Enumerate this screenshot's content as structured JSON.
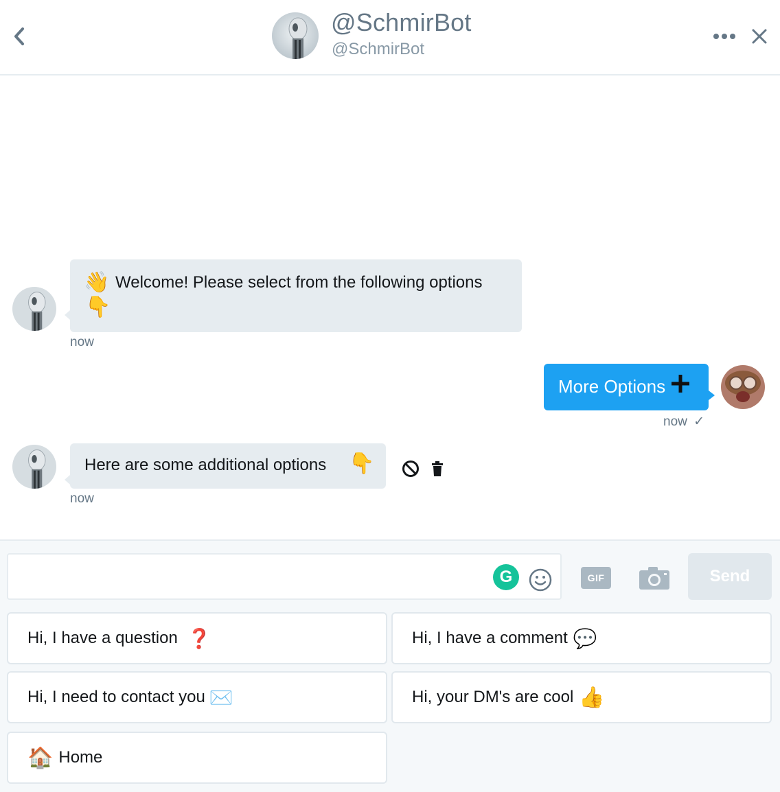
{
  "header": {
    "title": "@SchmirBot",
    "subtitle": "@SchmirBot",
    "icons": {
      "back": "chevron-left-icon",
      "more": "more-dots-icon",
      "close": "close-icon"
    }
  },
  "messages": {
    "welcome": {
      "text": "Welcome! Please select from the following options",
      "emoji_lead": "👋",
      "emoji_trail": "👇",
      "time": "now"
    },
    "user_reply": {
      "text": "More Options",
      "emoji": "➕",
      "time": "now",
      "status_icon": "✓"
    },
    "additional": {
      "text": "Here are some additional options",
      "emoji": "👇",
      "time": "now"
    }
  },
  "composer": {
    "placeholder": "",
    "grammarly": "G",
    "gif": "GIF",
    "send": "Send"
  },
  "quick_replies": [
    {
      "label": "Hi, I have a question",
      "emoji": "❓"
    },
    {
      "label": "Hi, I have a comment",
      "emoji": "💬"
    },
    {
      "label": "Hi, I need to contact you",
      "emoji": "✉️"
    },
    {
      "label": "Hi, your DM's are cool",
      "emoji": "👍"
    },
    {
      "label": "Home",
      "emoji": "🏠"
    }
  ],
  "colors": {
    "accent": "#1da1f2",
    "bubble_in": "#e6ecf0",
    "grammarly": "#15c39a"
  }
}
